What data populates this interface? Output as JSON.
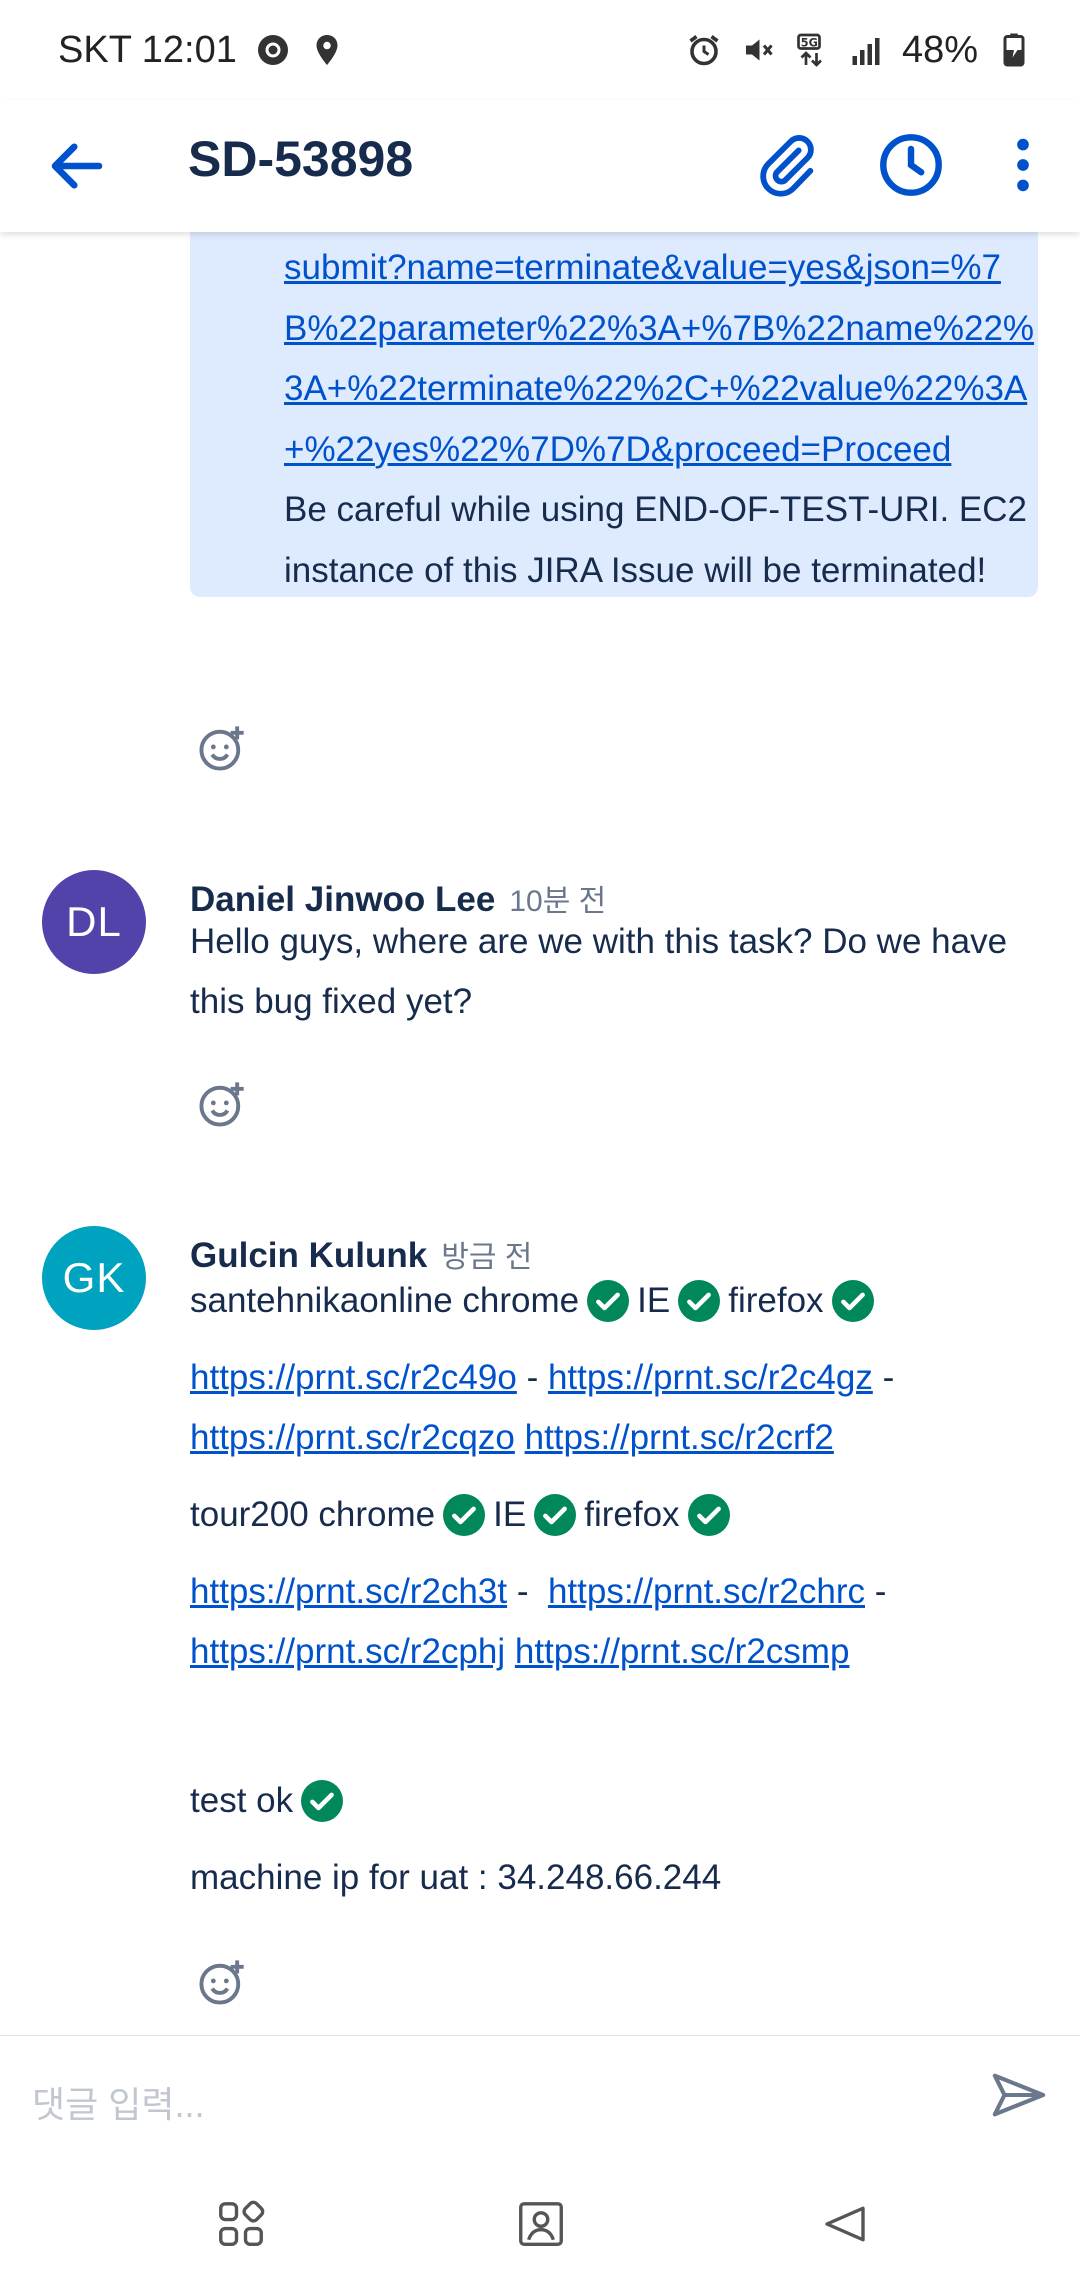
{
  "status_bar": {
    "carrier_time": "SKT 12:01",
    "battery": "48%"
  },
  "app_bar": {
    "title": "SD-53898",
    "icons": [
      "back-arrow-icon",
      "attachment-icon",
      "clock-icon",
      "more-vert-icon"
    ]
  },
  "quote": {
    "link_lines": [
      "submit?name=terminate&value=yes&json=%7",
      "B%22parameter%22%3A+%7B%22name%22%",
      "3A+%22terminate%22%2C+%22value%22%3A",
      "+%22yes%22%7D%7D&proceed=Proceed"
    ],
    "warning_lines": [
      "Be careful while using END-OF-TEST-URI. EC2",
      "instance of this JIRA Issue will be terminated!"
    ]
  },
  "comments": [
    {
      "initials": "DL",
      "author": "Daniel Jinwoo Lee",
      "time": "10분 전",
      "avatar_color": "#5243aa",
      "lines": [
        "Hello guys, where are we with this task? Do we have",
        "this bug fixed yet?"
      ]
    },
    {
      "initials": "GK",
      "author": "Gulcin Kulunk",
      "time": "방금 전",
      "avatar_color": "#00a3bf",
      "row1": {
        "site": "santehnikaonline chrome",
        "ie": "IE",
        "ff": "firefox"
      },
      "links1": [
        "https://prnt.sc/r2c49o",
        "-",
        "https://prnt.sc/r2c4gz",
        "-",
        "https://prnt.sc/r2cqzo",
        "https://prnt.sc/r2crf2"
      ],
      "row2": {
        "site": "tour200 chrome",
        "ie": "IE",
        "ff": "firefox"
      },
      "links2": [
        "https://prnt.sc/r2ch3t",
        "-",
        "https://prnt.sc/r2chrc",
        "-",
        "https://prnt.sc/r2cphj",
        "https://prnt.sc/r2csmp"
      ],
      "test_ok": "test ok",
      "machine_ip": "machine ip for uat : 34.248.66.244"
    }
  ],
  "input": {
    "placeholder": "댓글 입력..."
  },
  "colors": {
    "brand": "#0052cc",
    "check": "#00875a",
    "quote_bg": "#deebff"
  }
}
